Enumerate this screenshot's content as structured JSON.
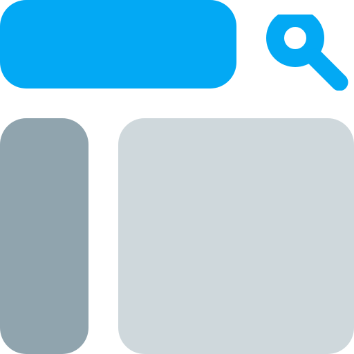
{
  "icon": {
    "name": "website-layout-search-icon",
    "colors": {
      "search_bar": "#03A9F4",
      "search_icon": "#03A9F4",
      "sidebar": "#90A4AE",
      "content": "#CFD8DC",
      "background": "#FFFFFF"
    },
    "parts": [
      "search-bar",
      "search-icon",
      "sidebar-panel",
      "content-panel"
    ]
  }
}
